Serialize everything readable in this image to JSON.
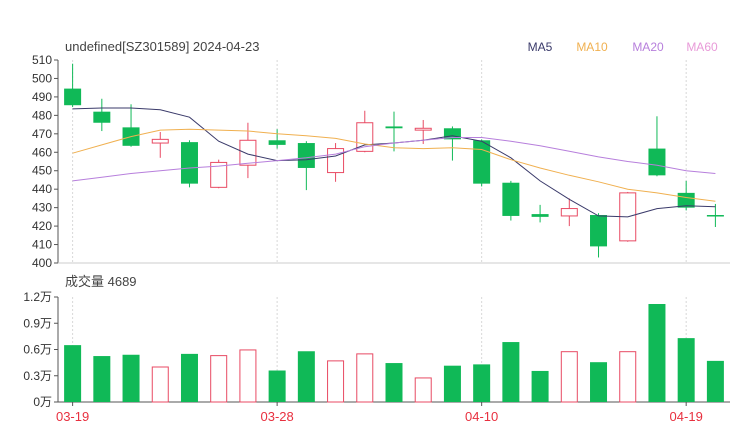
{
  "header": {
    "title": "undefined[SZ301589] 2024-04-23",
    "legend": [
      {
        "label": "MA5",
        "color": "#3a3a6a"
      },
      {
        "label": "MA10",
        "color": "#f0b050"
      },
      {
        "label": "MA20",
        "color": "#b77fdc"
      },
      {
        "label": "MA60",
        "color": "#e89ad8"
      }
    ]
  },
  "volume_header": {
    "label": "成交量 4689"
  },
  "colors": {
    "up": "#e84a63",
    "down": "#10b957",
    "grid": "#e8e8e8",
    "axis": "#555555",
    "date": "#e8303f"
  },
  "chart_data": [
    {
      "type": "candlestick",
      "title": "undefined[SZ301589] 2024-04-23",
      "ylim": [
        400,
        510
      ],
      "yticks": [
        "510",
        "500",
        "490",
        "480",
        "470",
        "460",
        "450",
        "440",
        "430",
        "420",
        "410",
        "400"
      ],
      "xticks": [
        {
          "index": 0,
          "label": "03-19"
        },
        {
          "index": 7,
          "label": "03-28"
        },
        {
          "index": 14,
          "label": "04-10"
        },
        {
          "index": 21,
          "label": "04-19"
        }
      ],
      "candles": [
        {
          "o": 494.5,
          "c": 485.5,
          "h": 508.0,
          "l": 484.5
        },
        {
          "o": 482.0,
          "c": 476.0,
          "h": 489.0,
          "l": 471.5
        },
        {
          "o": 473.5,
          "c": 463.5,
          "h": 486.0,
          "l": 463.0
        },
        {
          "o": 465.0,
          "c": 467.0,
          "h": 471.0,
          "l": 457.0
        },
        {
          "o": 465.5,
          "c": 443.0,
          "h": 466.5,
          "l": 441.0
        },
        {
          "o": 441.0,
          "c": 454.5,
          "h": 456.0,
          "l": 440.5
        },
        {
          "o": 453.0,
          "c": 466.5,
          "h": 476.0,
          "l": 446.0
        },
        {
          "o": 466.5,
          "c": 464.0,
          "h": 472.5,
          "l": 462.0
        },
        {
          "o": 465.0,
          "c": 451.5,
          "h": 466.0,
          "l": 439.5
        },
        {
          "o": 449.0,
          "c": 462.0,
          "h": 465.0,
          "l": 444.0
        },
        {
          "o": 460.5,
          "c": 476.0,
          "h": 482.5,
          "l": 460.0
        },
        {
          "o": 474.0,
          "c": 473.0,
          "h": 482.0,
          "l": 460.5
        },
        {
          "o": 472.0,
          "c": 473.0,
          "h": 477.5,
          "l": 464.5
        },
        {
          "o": 473.0,
          "c": 467.0,
          "h": 474.0,
          "l": 455.5
        },
        {
          "o": 466.5,
          "c": 443.0,
          "h": 467.0,
          "l": 441.5
        },
        {
          "o": 443.5,
          "c": 425.5,
          "h": 444.5,
          "l": 423.0
        },
        {
          "o": 426.5,
          "c": 425.0,
          "h": 431.5,
          "l": 422.0
        },
        {
          "o": 425.5,
          "c": 429.5,
          "h": 435.0,
          "l": 420.0
        },
        {
          "o": 426.0,
          "c": 409.0,
          "h": 427.0,
          "l": 403.0
        },
        {
          "o": 412.0,
          "c": 438.0,
          "h": 438.5,
          "l": 411.5
        },
        {
          "o": 462.0,
          "c": 447.5,
          "h": 479.5,
          "l": 447.0
        },
        {
          "o": 438.0,
          "c": 430.0,
          "h": 444.5,
          "l": 428.5
        },
        {
          "o": 426.0,
          "c": 426.0,
          "h": 432.0,
          "l": 419.5
        }
      ],
      "series": [
        {
          "name": "MA5",
          "color": "#3a3a6a",
          "values": [
            483.5,
            484.0,
            484.0,
            483.0,
            479.0,
            466.0,
            459.0,
            455.5,
            456.0,
            458.0,
            464.0,
            465.0,
            466.5,
            469.0,
            466.0,
            457.0,
            444.5,
            434.5,
            425.5,
            425.0,
            429.5,
            431.0,
            430.5
          ]
        },
        {
          "name": "MA10",
          "color": "#f0b050",
          "values": [
            459.5,
            464.0,
            468.5,
            472.0,
            472.5,
            472.0,
            471.5,
            470.0,
            469.0,
            467.5,
            464.5,
            462.5,
            462.0,
            462.5,
            461.5,
            456.0,
            451.5,
            447.5,
            444.0,
            440.0,
            438.0,
            435.5,
            433.5
          ]
        },
        {
          "name": "MA20",
          "color": "#b77fdc",
          "values": [
            444.5,
            446.5,
            448.5,
            450.0,
            451.5,
            452.5,
            454.0,
            455.5,
            457.0,
            459.0,
            463.0,
            465.0,
            466.5,
            468.0,
            468.0,
            466.0,
            463.5,
            460.5,
            457.5,
            455.0,
            453.0,
            450.0,
            448.5
          ]
        }
      ]
    },
    {
      "type": "bar",
      "title": "成交量 4689",
      "ylim": [
        0,
        12000
      ],
      "yticks": [
        "1.2万",
        "0.9万",
        "0.6万",
        "0.3万",
        "0万"
      ],
      "values": [
        6500,
        5250,
        5400,
        4000,
        5500,
        5300,
        5950,
        3600,
        5800,
        4700,
        5500,
        4450,
        2750,
        4150,
        4300,
        6850,
        3550,
        5750,
        4550,
        5750,
        11200,
        7300,
        4700
      ]
    }
  ]
}
